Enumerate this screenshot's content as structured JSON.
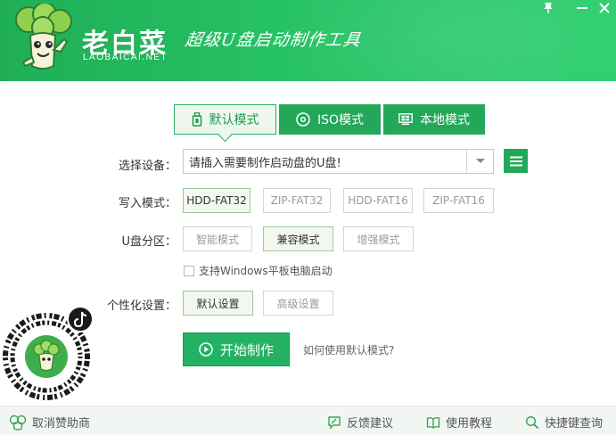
{
  "header": {
    "brand_name": "老白菜",
    "brand_domain": "LAOBAICAI.NET",
    "slogan": "超级U盘启动制作工具",
    "brand_color": "#23a85a"
  },
  "tabs": [
    {
      "label": "默认模式",
      "icon": "usb-drive-icon",
      "active": true
    },
    {
      "label": "ISO模式",
      "icon": "disc-icon",
      "active": false
    },
    {
      "label": "本地模式",
      "icon": "windows-icon",
      "active": false
    }
  ],
  "device": {
    "label": "选择设备：",
    "value": "请插入需要制作启动盘的U盘!"
  },
  "write_mode": {
    "label": "写入模式：",
    "options": [
      "HDD-FAT32",
      "ZIP-FAT32",
      "HDD-FAT16",
      "ZIP-FAT16"
    ],
    "selected": "HDD-FAT32"
  },
  "partition": {
    "label": "U盘分区：",
    "options": [
      "智能模式",
      "兼容模式",
      "增强模式"
    ],
    "selected": "兼容模式"
  },
  "windows_tablet": {
    "label": "支持Windows平板电脑启动",
    "checked": false
  },
  "personalize": {
    "label": "个性化设置：",
    "options": [
      "默认设置",
      "高级设置"
    ],
    "selected": "默认设置"
  },
  "actions": {
    "start_label": "开始制作",
    "help_link": "如何使用默认模式?"
  },
  "footer": {
    "cancel_sponsor": "取消赞助商",
    "feedback": "反馈建议",
    "tutorial": "使用教程",
    "shortcut_query": "快捷键查询"
  }
}
